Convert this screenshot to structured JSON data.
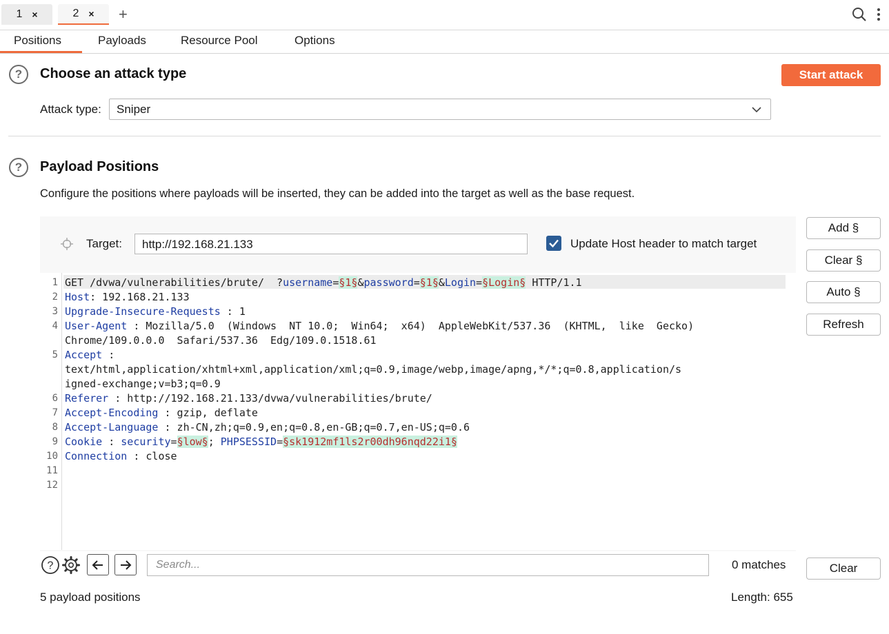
{
  "tabs": {
    "items": [
      {
        "label": "1",
        "close": "×"
      },
      {
        "label": "2",
        "close": "×"
      }
    ],
    "add": "+"
  },
  "subtabs": [
    "Positions",
    "Payloads",
    "Resource Pool",
    "Options"
  ],
  "attack": {
    "help": "?",
    "heading": "Choose an attack type",
    "start_label": "Start attack",
    "type_label": "Attack type:",
    "type_value": "Sniper"
  },
  "positions": {
    "help": "?",
    "heading": "Payload Positions",
    "description": "Configure the positions where payloads will be inserted, they can be added into the target as well as the base request.",
    "target_label": "Target:",
    "target_value": "http://192.168.21.133",
    "update_host_label": "Update Host header to match target",
    "update_host_checked": true
  },
  "buttons": {
    "add": "Add §",
    "clear": "Clear §",
    "auto": "Auto §",
    "refresh": "Refresh",
    "clear_search": "Clear"
  },
  "request": {
    "line_numbers": [
      "1",
      "2",
      "3",
      "4",
      "",
      "5",
      "",
      "",
      "6",
      "7",
      "8",
      "9",
      "10",
      "11",
      "12"
    ],
    "l1": {
      "a": "GET /dvwa/vulnerabilities/brute/  ?",
      "k1": "username",
      "e1": "=",
      "m1": "§1§",
      "amp1": "&",
      "k2": "password",
      "e2": "=",
      "m2": "§1§",
      "amp2": "&",
      "k3": "Login",
      "e3": "=",
      "m3": "§Login§",
      "b": " HTTP/1.1"
    },
    "l2": {
      "k": "Host",
      "v": ": 192.168.21.133"
    },
    "l3": {
      "k": "Upgrade-Insecure-Requests",
      "v": " : 1"
    },
    "l4": {
      "k": "User-Agent",
      "v": " : Mozilla/5.0  (Windows  NT 10.0;  Win64;  x64)  AppleWebKit/537.36  (KHTML,  like  Gecko)"
    },
    "l4b": "Chrome/109.0.0.0  Safari/537.36  Edg/109.0.1518.61",
    "l5": {
      "k": "Accept",
      "v": " :"
    },
    "l5b": "text/html,application/xhtml+xml,application/xml;q=0.9,image/webp,image/apng,*/*;q=0.8,application/s",
    "l5c": "igned-exchange;v=b3;q=0.9",
    "l6": {
      "k": "Referer",
      "v": " : http://192.168.21.133/dvwa/vulnerabilities/brute/"
    },
    "l7": {
      "k": "Accept-Encoding",
      "v": " : gzip, deflate"
    },
    "l8": {
      "k": "Accept-Language",
      "v": " : zh-CN,zh;q=0.9,en;q=0.8,en-GB;q=0.7,en-US;q=0.6"
    },
    "l9": {
      "k": "Cookie",
      "v": " : ",
      "k2": "security",
      "e": "=",
      "m1": "§low§",
      "sep": "; ",
      "k3": "PHPSESSID",
      "e2": "=",
      "m2": "§sk1912mf1ls2r00dh96nqd22i1§"
    },
    "l10": {
      "k": "Connection",
      "v": " : close"
    }
  },
  "search": {
    "placeholder": "Search...",
    "matches": "0 matches"
  },
  "footer": {
    "payload_positions": "5 payload positions",
    "length": "Length: 655"
  },
  "colors": {
    "accent": "#f26a3c",
    "keyword": "#1f3ea3",
    "marker_bg": "#c9f0df",
    "marker_fg": "#b63030",
    "checkbox": "#2b5c95"
  }
}
